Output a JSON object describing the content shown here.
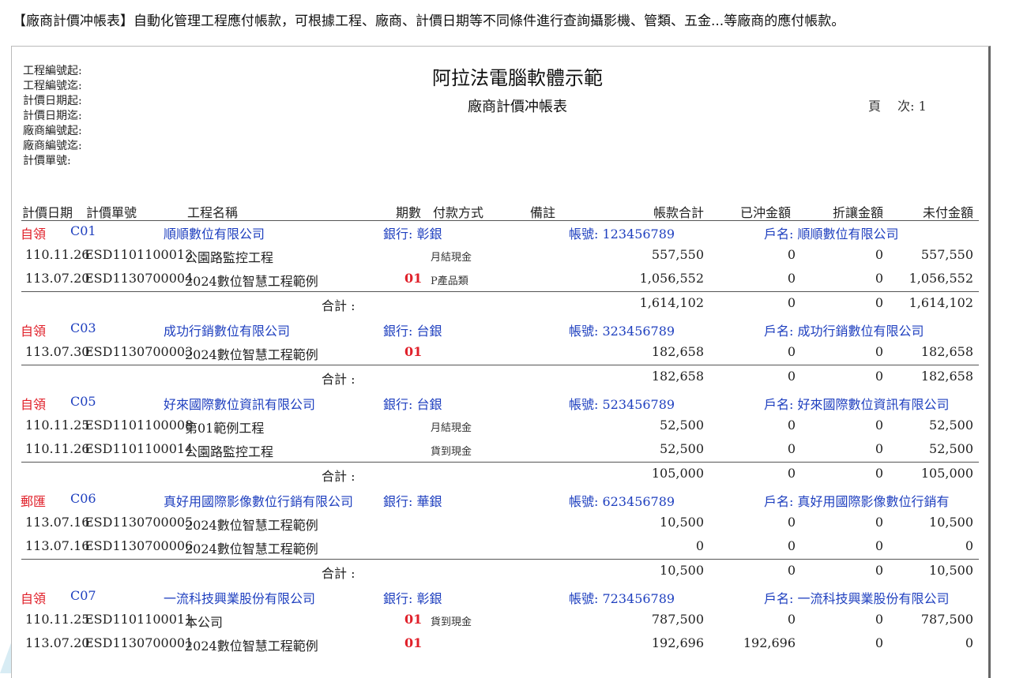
{
  "headline": "【廠商計價冲帳表】自動化管理工程應付帳款，可根據工程、廠商、計價日期等不同條件進行查詢攝影機、管類、五金...等廠商的應付帳款。",
  "criteria": [
    "工程編號起:",
    "工程編號迄:",
    "計價日期起:",
    "計價日期迄:",
    "廠商編號起:",
    "廠商編號迄:",
    "計價單號:"
  ],
  "company": "阿拉法電腦軟體示範",
  "report_title": "廠商計價冲帳表",
  "page_label": "頁　 次:",
  "page_no": "1",
  "columns": {
    "date": "計價日期",
    "no": "計價單號",
    "project": "工程名稱",
    "period": "期數",
    "pay": "付款方式",
    "note": "備註",
    "total": "帳款合計",
    "paid": "已沖金額",
    "discount": "折讓金額",
    "unpaid": "未付金額"
  },
  "subtotal_label": "合計 :",
  "vendors": [
    {
      "type": "自領",
      "code": "C01",
      "name": "順順數位有限公司",
      "bank": "銀行: 彰銀",
      "account": "帳號: 123456789",
      "holder": "戶名: 順順數位有限公司",
      "rows": [
        {
          "date": "110.11.26",
          "no": "ESD1101100013",
          "project": "公園路監控工程",
          "period": "",
          "pay": "月結現金",
          "total": "557,550",
          "paid": "0",
          "discount": "0",
          "unpaid": "557,550"
        },
        {
          "date": "113.07.20",
          "no": "ESD1130700004",
          "project": "2024數位智慧工程範例",
          "period": "01",
          "pay": "P產品類",
          "total": "1,056,552",
          "paid": "0",
          "discount": "0",
          "unpaid": "1,056,552"
        }
      ],
      "sum": {
        "total": "1,614,102",
        "paid": "0",
        "discount": "0",
        "unpaid": "1,614,102"
      }
    },
    {
      "type": "自領",
      "code": "C03",
      "name": "成功行銷數位有限公司",
      "bank": "銀行: 台銀",
      "account": "帳號: 323456789",
      "holder": "戶名: 成功行銷數位有限公司",
      "rows": [
        {
          "date": "113.07.30",
          "no": "ESD1130700003",
          "project": "2024數位智慧工程範例",
          "period": "01",
          "pay": "",
          "total": "182,658",
          "paid": "0",
          "discount": "0",
          "unpaid": "182,658"
        }
      ],
      "sum": {
        "total": "182,658",
        "paid": "0",
        "discount": "0",
        "unpaid": "182,658"
      }
    },
    {
      "type": "自領",
      "code": "C05",
      "name": "好來國際數位資訊有限公司",
      "bank": "銀行: 台銀",
      "account": "帳號: 523456789",
      "holder": "戶名: 好來國際數位資訊有限公司",
      "rows": [
        {
          "date": "110.11.25",
          "no": "ESD1101100008",
          "project": "第01範例工程",
          "period": "",
          "pay": "月結現金",
          "total": "52,500",
          "paid": "0",
          "discount": "0",
          "unpaid": "52,500"
        },
        {
          "date": "110.11.26",
          "no": "ESD1101100014",
          "project": "公園路監控工程",
          "period": "",
          "pay": "貨到現金",
          "total": "52,500",
          "paid": "0",
          "discount": "0",
          "unpaid": "52,500"
        }
      ],
      "sum": {
        "total": "105,000",
        "paid": "0",
        "discount": "0",
        "unpaid": "105,000"
      }
    },
    {
      "type": "郵匯",
      "code": "C06",
      "name": "真好用國際影像數位行銷有限公司",
      "bank": "銀行: 華銀",
      "account": "帳號: 623456789",
      "holder": "戶名: 真好用國際影像數位行銷有",
      "rows": [
        {
          "date": "113.07.16",
          "no": "ESD1130700005",
          "project": "2024數位智慧工程範例",
          "period": "",
          "pay": "",
          "total": "10,500",
          "paid": "0",
          "discount": "0",
          "unpaid": "10,500"
        },
        {
          "date": "113.07.16",
          "no": "ESD1130700006",
          "project": "2024數位智慧工程範例",
          "period": "",
          "pay": "",
          "total": "0",
          "paid": "0",
          "discount": "0",
          "unpaid": "0"
        }
      ],
      "sum": {
        "total": "10,500",
        "paid": "0",
        "discount": "0",
        "unpaid": "10,500"
      }
    },
    {
      "type": "自領",
      "code": "C07",
      "name": "一流科技興業股份有限公司",
      "bank": "銀行: 彰銀",
      "account": "帳號: 723456789",
      "holder": "戶名: 一流科技興業股份有限公司",
      "rows": [
        {
          "date": "110.11.25",
          "no": "ESD1101100011",
          "project": "本公司",
          "period": "01",
          "pay": "貨到現金",
          "total": "787,500",
          "paid": "0",
          "discount": "0",
          "unpaid": "787,500"
        },
        {
          "date": "113.07.20",
          "no": "ESD1130700001",
          "project": "2024數位智慧工程範例",
          "period": "01",
          "pay": "",
          "total": "192,696",
          "paid": "192,696",
          "discount": "0",
          "unpaid": "0"
        }
      ],
      "sum": null
    }
  ]
}
